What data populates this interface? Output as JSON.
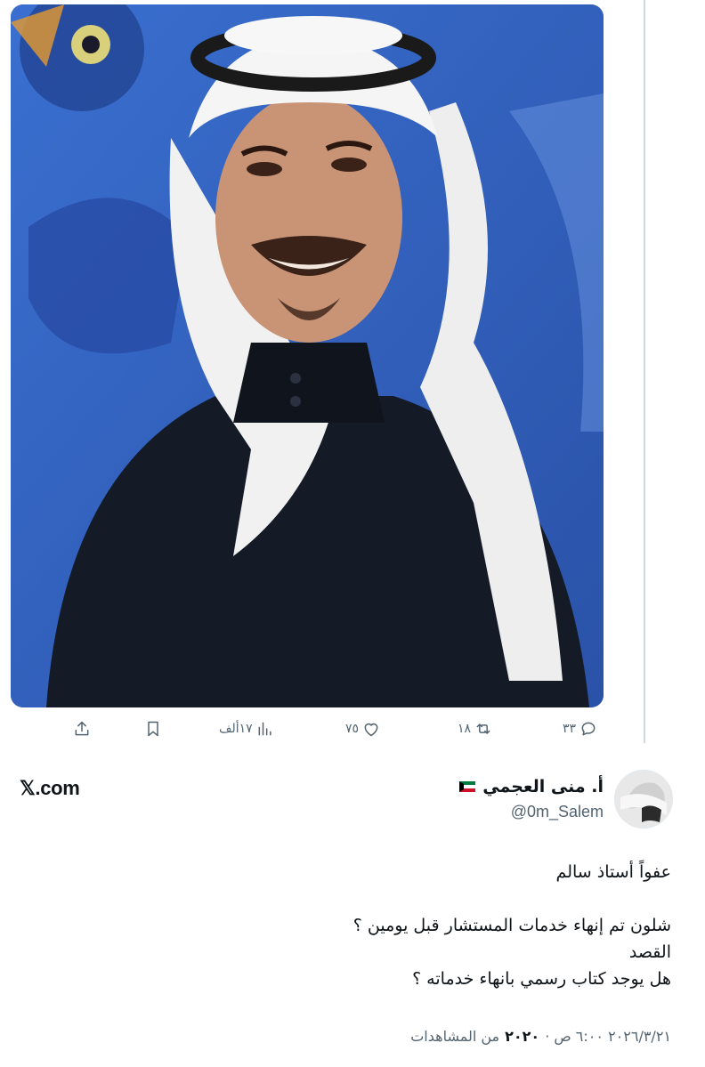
{
  "media": {
    "alt_icon": "photo"
  },
  "actions": {
    "reply_count": "٣٣",
    "repost_count": "١٨",
    "like_count": "٧٥",
    "views_count": "١٧ألف"
  },
  "brand": {
    "site": "𝕏.com"
  },
  "author": {
    "display_name": "أ. منى العجمي",
    "handle": "@0m_Salem",
    "flag_icon": "kuwait-flag-icon"
  },
  "tweet": {
    "line1": "عفواً أستاذ سالم",
    "line2": "شلون تم إنهاء خدمات المستشار قبل يومين ؟",
    "line3": "القصد",
    "line4": "هل يوجد كتاب رسمي بانهاء خدماته ؟"
  },
  "meta": {
    "timestamp": "٢٠٢٦/٣/٢١ ٦:٠٠ ص · ",
    "views_count": "٢٠٢٠",
    "views_label": "من المشاهدات"
  },
  "colors": {
    "background": "#ffffff",
    "muted": "#536471",
    "photo_bg": "#2f5db8"
  }
}
